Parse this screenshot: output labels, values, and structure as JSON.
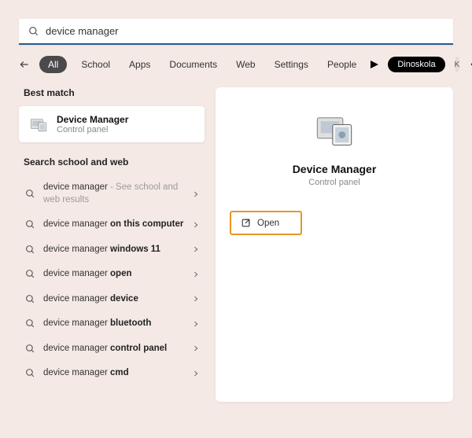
{
  "search": {
    "value": "device manager"
  },
  "filters": {
    "active": "All",
    "items": [
      "School",
      "Apps",
      "Documents",
      "Web",
      "Settings",
      "People"
    ],
    "brand": "Dinoskola",
    "avatar_initial": "K"
  },
  "sections": {
    "best_match": "Best match",
    "search_school_web": "Search school and web"
  },
  "best": {
    "title": "Device Manager",
    "subtitle": "Control panel"
  },
  "suggestions": [
    {
      "prefix": "device manager",
      "suffix_light": " - See school and web results",
      "suffix_bold": ""
    },
    {
      "prefix": "device manager ",
      "suffix_light": "",
      "suffix_bold": "on this computer"
    },
    {
      "prefix": "device manager ",
      "suffix_light": "",
      "suffix_bold": "windows 11"
    },
    {
      "prefix": "device manager ",
      "suffix_light": "",
      "suffix_bold": "open"
    },
    {
      "prefix": "device manager ",
      "suffix_light": "",
      "suffix_bold": "device"
    },
    {
      "prefix": "device manager ",
      "suffix_light": "",
      "suffix_bold": "bluetooth"
    },
    {
      "prefix": "device manager ",
      "suffix_light": "",
      "suffix_bold": "control panel"
    },
    {
      "prefix": "device manager ",
      "suffix_light": "",
      "suffix_bold": "cmd"
    }
  ],
  "preview": {
    "title": "Device Manager",
    "subtitle": "Control panel",
    "open_label": "Open"
  }
}
